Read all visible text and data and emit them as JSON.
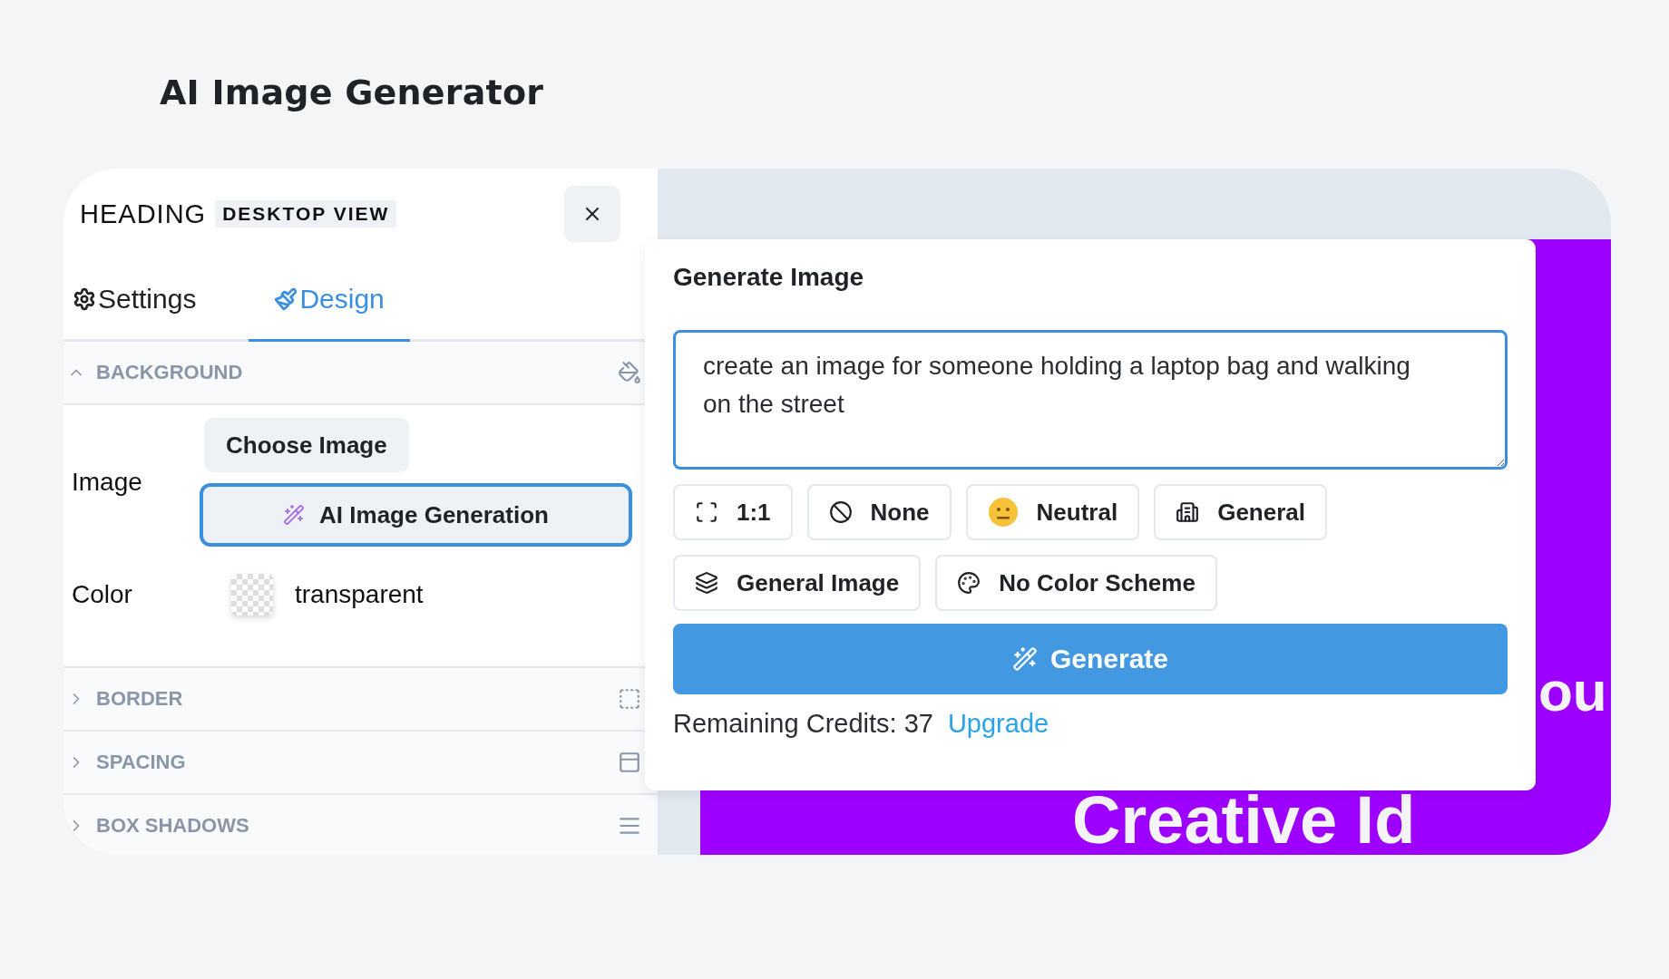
{
  "page_title": "AI Image Generator",
  "panel": {
    "element": "HEADING",
    "view_badge": "DESKTOP VIEW"
  },
  "tabs": [
    {
      "label": "Settings",
      "selected": false
    },
    {
      "label": "Design",
      "selected": true
    }
  ],
  "sections": [
    {
      "title": "BACKGROUND",
      "expanded": true
    },
    {
      "title": "BORDER",
      "expanded": false
    },
    {
      "title": "SPACING",
      "expanded": false
    },
    {
      "title": "BOX SHADOWS",
      "expanded": false
    }
  ],
  "background": {
    "image_label": "Image",
    "choose_button": "Choose Image",
    "ai_button": "AI Image Generation",
    "color_label": "Color",
    "color_value": "transparent"
  },
  "canvas_texts": [
    "ou",
    "Creative Id"
  ],
  "modal": {
    "title": "Generate Image",
    "prompt": "create an image for someone holding a laptop bag and walking on the street",
    "option_rows": [
      [
        "1:1",
        "None",
        "Neutral",
        "General"
      ],
      [
        "General Image",
        "No Color Scheme"
      ]
    ],
    "generate_button": "Generate",
    "credits_label": "Remaining Credits: 37",
    "upgrade_link": "Upgrade"
  }
}
